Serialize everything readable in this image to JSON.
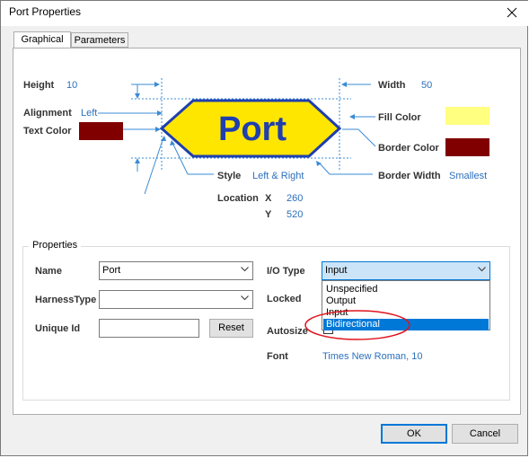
{
  "window": {
    "title": "Port Properties"
  },
  "tabs": [
    {
      "label": "Graphical"
    },
    {
      "label": "Parameters"
    }
  ],
  "graphical": {
    "height_label": "Height",
    "height_value": "10",
    "width_label": "Width",
    "width_value": "50",
    "alignment_label": "Alignment",
    "alignment_value": "Left",
    "text_color_label": "Text Color",
    "text_color": "#800000",
    "fill_color_label": "Fill Color",
    "fill_color": "#ffff80",
    "border_color_label": "Border Color",
    "border_color": "#800000",
    "style_label": "Style",
    "style_value": "Left & Right",
    "border_width_label": "Border Width",
    "border_width_value": "Smallest",
    "location_label": "Location",
    "x_label": "X",
    "x_value": "260",
    "y_label": "Y",
    "y_value": "520",
    "preview_text": "Port",
    "preview_fill": "#ffe600",
    "preview_border": "#1f3fae",
    "preview_text_color": "#1f3fae"
  },
  "properties": {
    "group_title": "Properties",
    "name_label": "Name",
    "name_value": "Port",
    "harness_label": "HarnessType",
    "harness_value": "",
    "unique_id_label": "Unique Id",
    "unique_id_value": "",
    "reset_label": "Reset",
    "io_type_label": "I/O Type",
    "io_type_value": "Input",
    "locked_label": "Locked",
    "autosize_label": "Autosize",
    "font_label": "Font",
    "font_value": "Times New Roman, 10"
  },
  "io_dropdown": {
    "options": [
      "Unspecified",
      "Output",
      "Input",
      "Bidirectional"
    ],
    "selected": "Bidirectional",
    "annotation_color": "#e0141e"
  },
  "footer": {
    "ok_label": "OK",
    "cancel_label": "Cancel"
  }
}
